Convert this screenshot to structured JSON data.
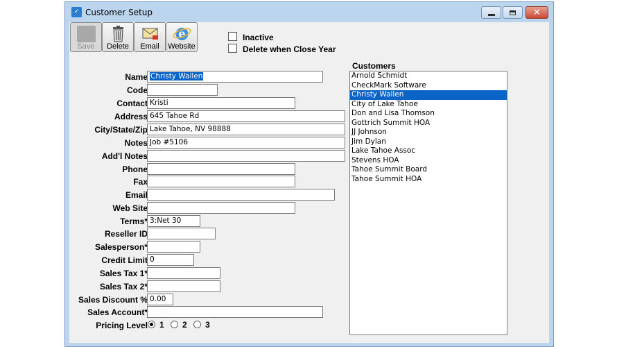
{
  "window": {
    "title": "Customer Setup"
  },
  "toolbar": {
    "save_label": "Save",
    "delete_label": "Delete",
    "email_label": "Email",
    "website_label": "Website"
  },
  "options": {
    "inactive_label": "Inactive",
    "delete_close_year_label": "Delete when Close Year"
  },
  "form": {
    "name_label": "Name",
    "name_value": "Christy Wallen",
    "code_label": "Code",
    "code_value": "",
    "contact_label": "Contact",
    "contact_value": "Kristi",
    "address_label": "Address",
    "address_value": "645 Tahoe Rd",
    "city_label": "City/State/Zip",
    "city_value": "Lake Tahoe, NV  98888",
    "notes_label": "Notes",
    "notes_value": "Job #5106",
    "addl_notes_label": "Add'l Notes",
    "addl_notes_value": "",
    "phone_label": "Phone",
    "phone_value": "",
    "fax_label": "Fax",
    "fax_value": "",
    "email_label": "Email",
    "email_value": "",
    "website_label": "Web Site",
    "website_value": "",
    "terms_label": "Terms*",
    "terms_value": "3:Net 30",
    "reseller_label": "Reseller ID",
    "reseller_value": "",
    "salesperson_label": "Salesperson*",
    "salesperson_value": "",
    "credit_label": "Credit Limit",
    "credit_value": "0",
    "tax1_label": "Sales Tax 1*",
    "tax1_value": "",
    "tax2_label": "Sales Tax 2*",
    "tax2_value": "",
    "discount_label": "Sales Discount %",
    "discount_value": "0.00",
    "account_label": "Sales Account*",
    "account_value": "",
    "pricing_label": "Pricing Level",
    "pricing_options": [
      "1",
      "2",
      "3"
    ],
    "pricing_selected": "1"
  },
  "customers": {
    "title": "Customers",
    "items": [
      "Arnold Schmidt",
      "CheckMark Software",
      "Christy Wallen",
      "City of Lake Tahoe",
      "Don and Lisa Thomson",
      "Gottrich Summit HOA",
      "JJ Johnson",
      "Jim Dylan",
      "Lake Tahoe Assoc",
      "Stevens HOA",
      "Tahoe Summit Board",
      "Tahoe Summit HOA"
    ],
    "selected": "Christy Wallen"
  },
  "icons": {
    "app": "customer-setup-app-icon",
    "delete": "trash-can-icon",
    "email": "envelope-icon",
    "website": "internet-explorer-icon"
  },
  "colors": {
    "selection": "#0a64c8",
    "window_frame": "#bcd5ee",
    "close_button": "#c94a32"
  }
}
